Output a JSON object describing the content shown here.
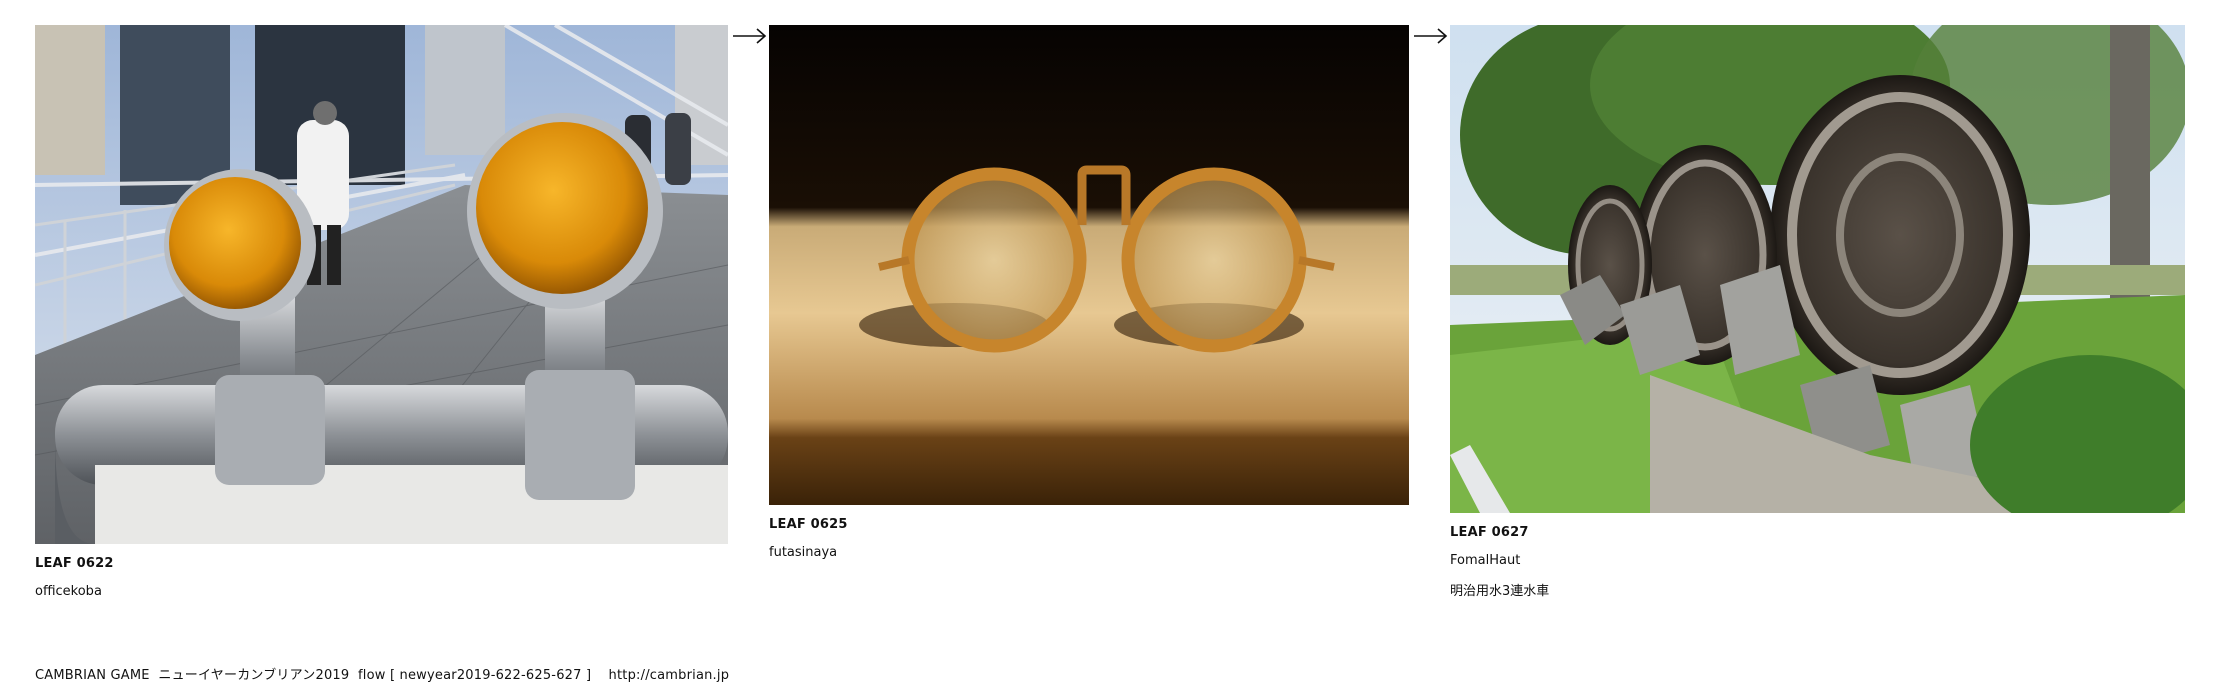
{
  "leaves": [
    {
      "id": "LEAF 0622",
      "author": "officekoba",
      "image": "amber-reflectors-on-bridge-photo"
    },
    {
      "id": "LEAF 0625",
      "author": "futasinaya",
      "image": "round-amber-glasses-photo"
    },
    {
      "id": "LEAF 0627",
      "author": "FomalHaut",
      "title": "明治用水3連水車",
      "image": "three-water-wheels-photo"
    }
  ],
  "arrows": [
    "arrow-right-icon",
    "arrow-right-icon"
  ],
  "footer": {
    "text": "CAMBRIAN GAME  ニューイヤーカンブリアン2019  flow [ newyear2019-622-625-627 ]    http://cambrian.jp"
  }
}
